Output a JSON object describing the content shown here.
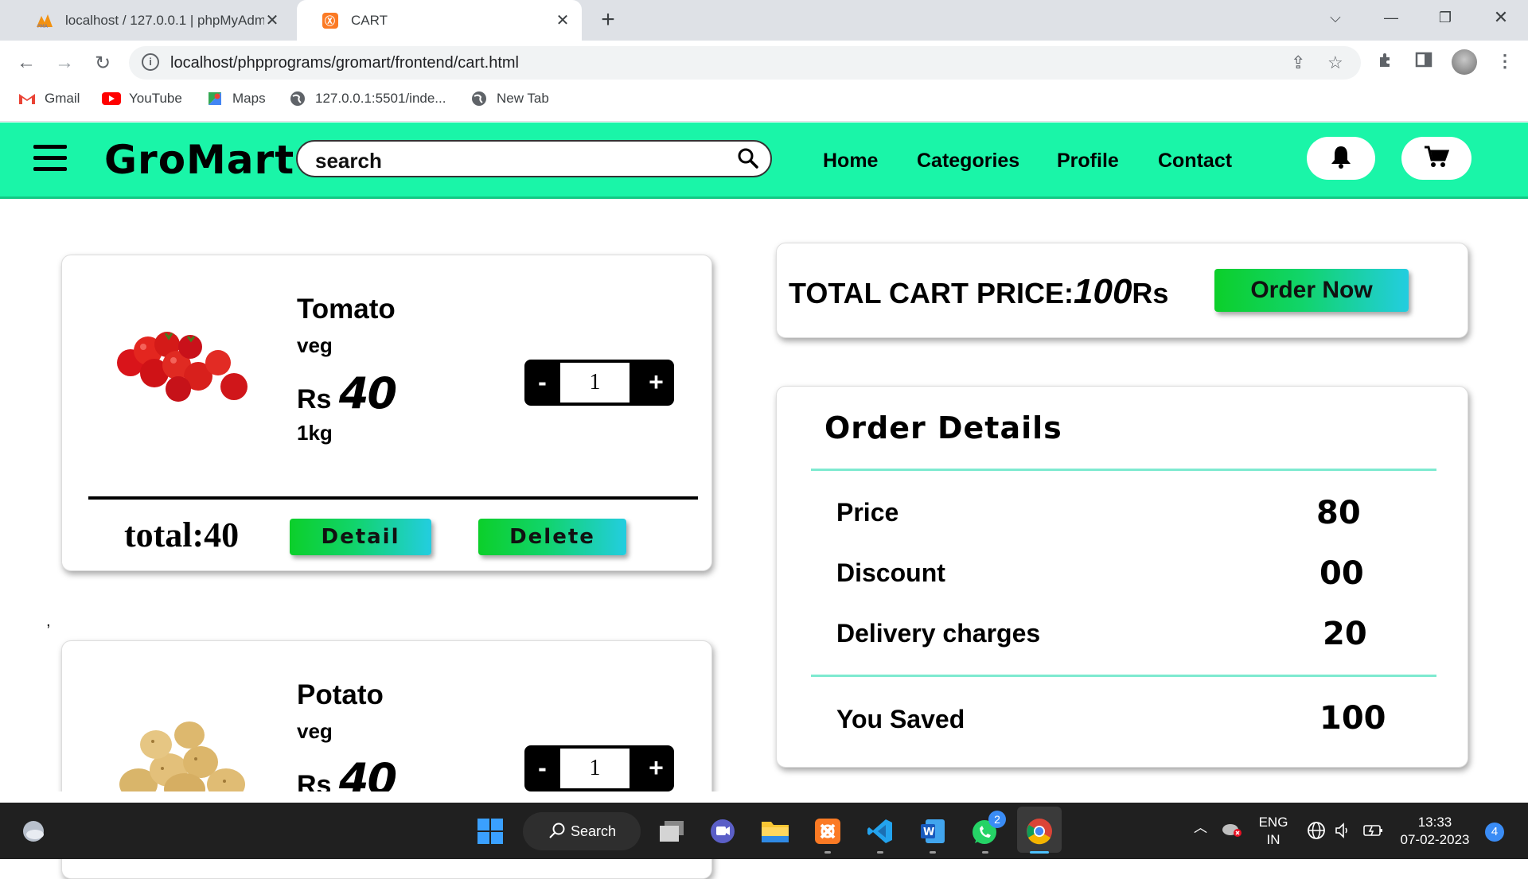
{
  "browser": {
    "tabs": [
      {
        "title": "localhost / 127.0.0.1 | phpMyAdmin",
        "active": false
      },
      {
        "title": "CART",
        "active": true
      }
    ],
    "url": "localhost/phpprograms/gromart/frontend/cart.html",
    "bookmarks": [
      "Gmail",
      "YouTube",
      "Maps",
      "127.0.0.1:5501/inde...",
      "New Tab"
    ]
  },
  "site": {
    "logo": "GroMart",
    "search_placeholder": "search",
    "nav": [
      "Home",
      "Categories",
      "Profile",
      "Contact"
    ]
  },
  "cart": {
    "items": [
      {
        "name": "Tomato",
        "category": "veg",
        "currency": "Rs",
        "price": "40",
        "weight": "1kg",
        "quantity": "1",
        "total": "total:40",
        "detail_label": "Detail",
        "delete_label": "Delete",
        "minus": "-",
        "plus": "+"
      },
      {
        "name": "Potato",
        "category": "veg",
        "currency": "Rs",
        "price": "40",
        "quantity": "1",
        "minus": "-",
        "plus": "+"
      }
    ],
    "stray_text": ",",
    "total_label": "TOTAL CART PRICE:",
    "total_amount": "100",
    "total_suffix": "Rs",
    "order_button": "Order Now"
  },
  "order_details": {
    "title": "Order Details",
    "rows": [
      {
        "label": "Price",
        "value": "80"
      },
      {
        "label": "Discount",
        "value": "00"
      },
      {
        "label": "Delivery charges",
        "value": "20"
      }
    ],
    "saved_label": "You Saved",
    "saved_value": "100"
  },
  "taskbar": {
    "search_label": "Search",
    "whatsapp_badge": "2",
    "language": "ENG",
    "region": "IN",
    "time": "13:33",
    "date": "07-02-2023",
    "notification_count": "4"
  },
  "colors": {
    "header_bg": "#1af5a8",
    "button_gradient_start": "#0ccf2a",
    "button_gradient_end": "#23cde0",
    "divider_accent": "#7eead0"
  }
}
